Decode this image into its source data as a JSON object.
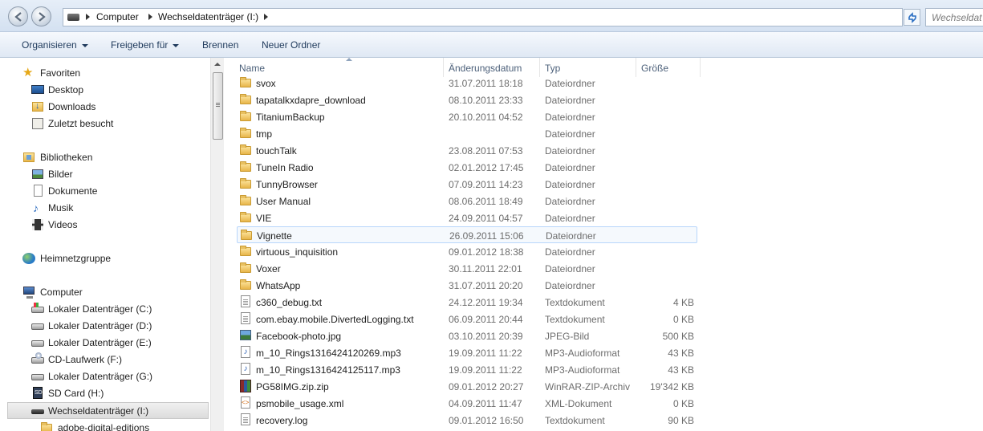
{
  "addressbar": {
    "crumbs": [
      "Computer",
      "Wechseldatenträger (I:)"
    ],
    "search_placeholder": "Wechseldat"
  },
  "toolbar": {
    "organize": "Organisieren",
    "share": "Freigeben für",
    "burn": "Brennen",
    "new_folder": "Neuer Ordner"
  },
  "nav": {
    "favorites": {
      "label": "Favoriten",
      "items": [
        "Desktop",
        "Downloads",
        "Zuletzt besucht"
      ]
    },
    "libraries": {
      "label": "Bibliotheken",
      "items": [
        "Bilder",
        "Dokumente",
        "Musik",
        "Videos"
      ]
    },
    "homegroup": "Heimnetzgruppe",
    "computer": {
      "label": "Computer",
      "items": [
        "Lokaler Datenträger (C:)",
        "Lokaler Datenträger (D:)",
        "Lokaler Datenträger (E:)",
        "CD-Laufwerk (F:)",
        "Lokaler Datenträger (G:)",
        "SD Card (H:)",
        "Wechseldatenträger (I:)",
        "adobe-digital-editions"
      ]
    }
  },
  "columns": {
    "name": "Name",
    "date": "Änderungsdatum",
    "type": "Typ",
    "size": "Größe"
  },
  "files": [
    {
      "name": "svox",
      "date": "31.07.2011 18:18",
      "type": "Dateiordner",
      "size": "",
      "icon": "folder-icon"
    },
    {
      "name": "tapatalkxdapre_download",
      "date": "08.10.2011 23:33",
      "type": "Dateiordner",
      "size": "",
      "icon": "folder-icon"
    },
    {
      "name": "TitaniumBackup",
      "date": "20.10.2011 04:52",
      "type": "Dateiordner",
      "size": "",
      "icon": "folder-icon"
    },
    {
      "name": "tmp",
      "date": "",
      "type": "Dateiordner",
      "size": "",
      "icon": "folder-icon"
    },
    {
      "name": "touchTalk",
      "date": "23.08.2011 07:53",
      "type": "Dateiordner",
      "size": "",
      "icon": "folder-icon"
    },
    {
      "name": "TuneIn Radio",
      "date": "02.01.2012 17:45",
      "type": "Dateiordner",
      "size": "",
      "icon": "folder-icon"
    },
    {
      "name": "TunnyBrowser",
      "date": "07.09.2011 14:23",
      "type": "Dateiordner",
      "size": "",
      "icon": "folder-icon"
    },
    {
      "name": "User Manual",
      "date": "08.06.2011 18:49",
      "type": "Dateiordner",
      "size": "",
      "icon": "folder-icon"
    },
    {
      "name": "VIE",
      "date": "24.09.2011 04:57",
      "type": "Dateiordner",
      "size": "",
      "icon": "folder-icon"
    },
    {
      "name": "Vignette",
      "date": "26.09.2011 15:06",
      "type": "Dateiordner",
      "size": "",
      "icon": "folder-icon"
    },
    {
      "name": "virtuous_inquisition",
      "date": "09.01.2012 18:38",
      "type": "Dateiordner",
      "size": "",
      "icon": "folder-icon"
    },
    {
      "name": "Voxer",
      "date": "30.11.2011 22:01",
      "type": "Dateiordner",
      "size": "",
      "icon": "folder-icon"
    },
    {
      "name": "WhatsApp",
      "date": "31.07.2011 20:20",
      "type": "Dateiordner",
      "size": "",
      "icon": "folder-icon"
    },
    {
      "name": "c360_debug.txt",
      "date": "24.12.2011 19:34",
      "type": "Textdokument",
      "size": "4 KB",
      "icon": "text-file-icon"
    },
    {
      "name": "com.ebay.mobile.DivertedLogging.txt",
      "date": "06.09.2011 20:44",
      "type": "Textdokument",
      "size": "0 KB",
      "icon": "text-file-icon"
    },
    {
      "name": "Facebook-photo.jpg",
      "date": "03.10.2011 20:39",
      "type": "JPEG-Bild",
      "size": "500 KB",
      "icon": "image-file-icon"
    },
    {
      "name": "m_10_Rings1316424120269.mp3",
      "date": "19.09.2011 11:22",
      "type": "MP3-Audioformat",
      "size": "43 KB",
      "icon": "audio-file-icon"
    },
    {
      "name": "m_10_Rings1316424125117.mp3",
      "date": "19.09.2011 11:22",
      "type": "MP3-Audioformat",
      "size": "43 KB",
      "icon": "audio-file-icon"
    },
    {
      "name": "PG58IMG.zip.zip",
      "date": "09.01.2012 20:27",
      "type": "WinRAR-ZIP-Archiv",
      "size": "19'342 KB",
      "icon": "archive-file-icon"
    },
    {
      "name": "psmobile_usage.xml",
      "date": "04.09.2011 11:47",
      "type": "XML-Dokument",
      "size": "0 KB",
      "icon": "xml-file-icon"
    },
    {
      "name": "recovery.log",
      "date": "09.01.2012 16:50",
      "type": "Textdokument",
      "size": "90 KB",
      "icon": "text-file-icon"
    }
  ],
  "selected_file": "Vignette",
  "colors": {
    "selection_bg": "#f5f9fd",
    "selection_border": "#b8d6fb",
    "header_text": "#4c607a",
    "toolbar_text": "#1e395b"
  }
}
